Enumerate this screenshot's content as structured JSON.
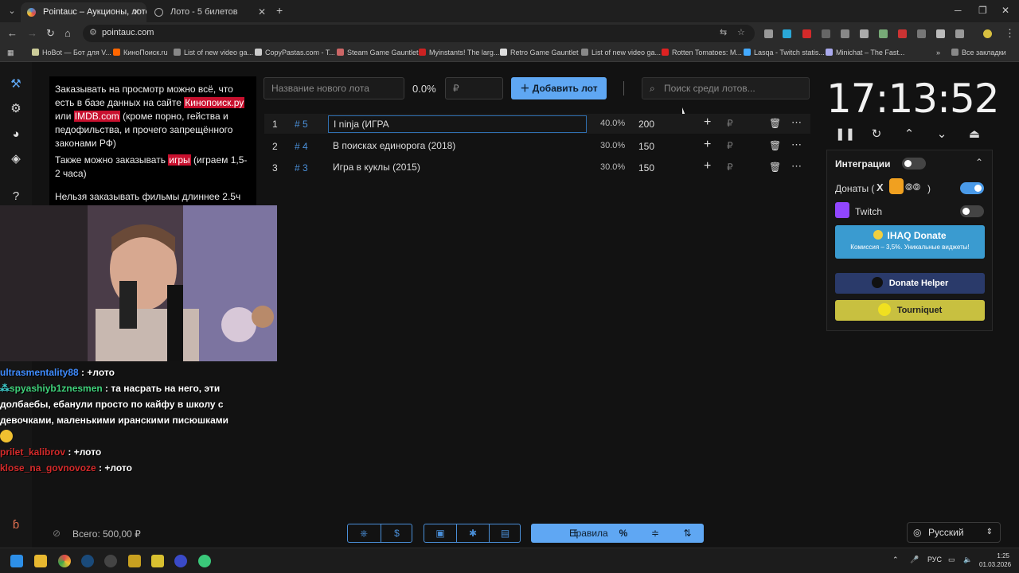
{
  "browser": {
    "tabs": [
      {
        "title": "Pointauc – Аукционы, лотереи",
        "active": true
      },
      {
        "title": "Лото - 5 билетов",
        "active": false
      }
    ],
    "url": "pointauc.com",
    "bookmarks": [
      "HoBot — Бот для V...",
      "КиноПоиск.ru",
      "List of new video ga...",
      "CopyPastas.com - T...",
      "Steam Game Gauntlet",
      "Myinstants! The larg...",
      "Retro Game Gauntlet",
      "List of new video ga...",
      "Rotten Tomatoes: M...",
      "Lasqa - Twitch statis...",
      "Minichat – The Fast..."
    ],
    "all_bookmarks": "Все закладки"
  },
  "rules_panel": {
    "line1": "Заказывать на просмотр можно всё, что есть в базе данных на сайте ",
    "link1": "Кинопоиск.ру",
    "line2": " или ",
    "link2": "IMDB.com",
    "line3": " (кроме порно, гейства и педофильства, и прочего запрещённого законами РФ)",
    "line4a": "Также можно заказывать ",
    "link3": "игры",
    "line4b": " (играем 1,5-2 часа)",
    "line5": "Нельзя заказывать фильмы длиннее 2.5ч"
  },
  "add_lot": {
    "name_placeholder": "Название нового лота",
    "percent": "0.0%",
    "amount_placeholder": "₽",
    "button_label": "Добавить лот",
    "search_placeholder": "Поиск среди лотов..."
  },
  "lots": [
    {
      "n": "1",
      "id": "# 5",
      "name": "I ninja (ИГРА",
      "pct": "40.0%",
      "amount": "200"
    },
    {
      "n": "2",
      "id": "# 4",
      "name": "В поисках единорога (2018)",
      "pct": "30.0%",
      "amount": "150"
    },
    {
      "n": "3",
      "id": "# 3",
      "name": "Игра в куклы (2015)",
      "pct": "30.0%",
      "amount": "150"
    }
  ],
  "timer": "17:13:52",
  "integrations": {
    "title": "Интеграции",
    "donations_label": "Донаты (",
    "twitch_label": "Twitch",
    "ihaq_title": "IHAQ Donate",
    "ihaq_sub": "Комиссия – 3,5%. Уникальные виджеты!",
    "donate_helper": "Donate Helper",
    "tourniquet": "Tourniquet"
  },
  "chat": [
    {
      "user": "ultrasmentality88",
      "color": "#3f8cff",
      "text": "+лото"
    },
    {
      "user": "spyashiyb1znesmen",
      "color": "#3fd17a",
      "text": "та насрать на него, эти долбаебы, ебанули просто по кайфу в школу с девочками, маленькими иранскими писюшками"
    },
    {
      "user": "prilet_kalibrov",
      "color": "#d42a2a",
      "text": "+лото"
    },
    {
      "user": "klose_na_govnovoze",
      "color": "#d42a2a",
      "text": "+лото"
    }
  ],
  "footer": {
    "total": "Всего: 500,00 ₽",
    "rules_label": "Правила",
    "percent_sign": "%",
    "language": "Русский"
  },
  "taskbar": {
    "lang": "РУС",
    "time": "1:25",
    "date": "01.03.2026"
  }
}
